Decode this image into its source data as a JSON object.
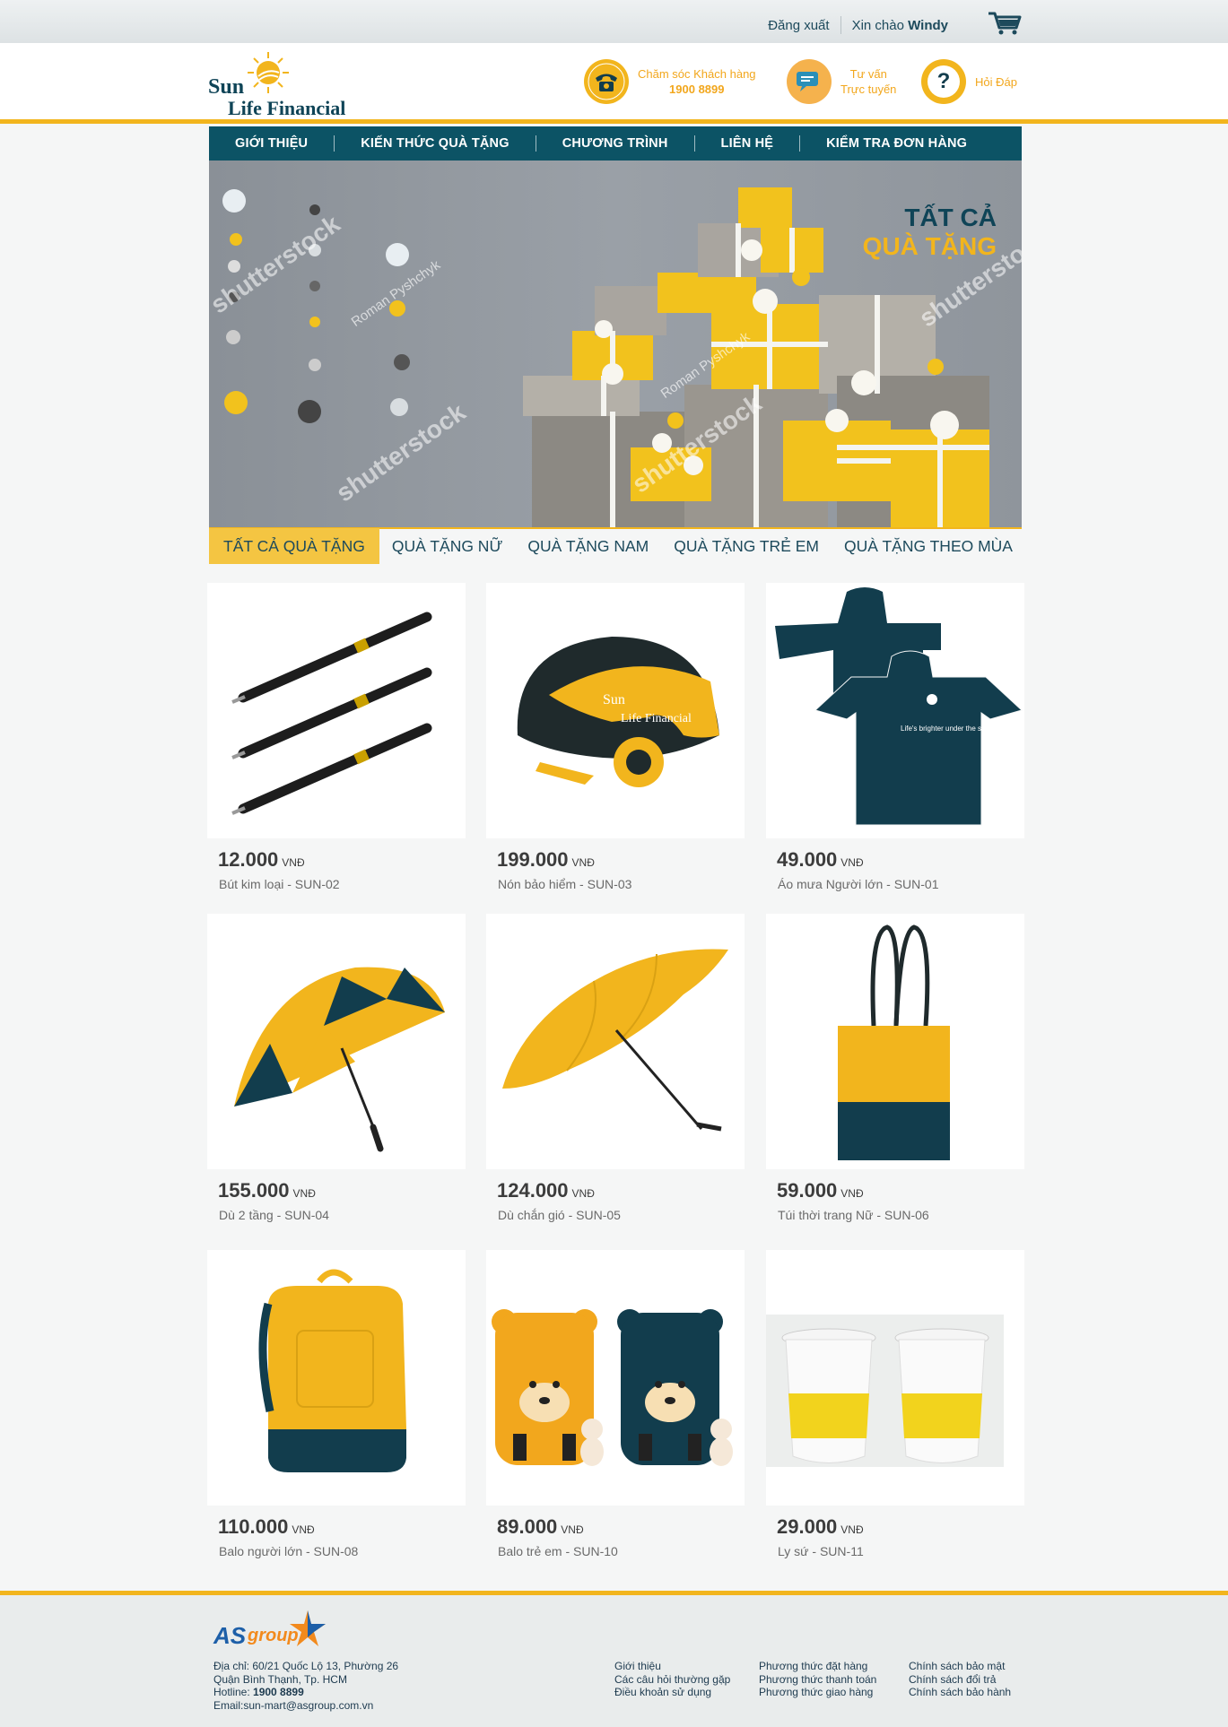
{
  "topbar": {
    "logout": "Đăng xuất",
    "greeting": "Xin chào",
    "username": "Windy"
  },
  "header": {
    "logo_sun": "Sun",
    "logo_lf": "Life Financial",
    "support_label": "Chăm sóc Khách hàng",
    "support_phone": "1900 8899",
    "consult_line1": "Tư vấn",
    "consult_line2": "Trực tuyến",
    "faq": "Hỏi Đáp"
  },
  "nav": {
    "items": [
      "GIỚI THIỆU",
      "KIẾN THỨC QUÀ TẶNG",
      "CHƯƠNG TRÌNH",
      "LIÊN HỆ",
      "KIỂM TRA ĐƠN HÀNG"
    ]
  },
  "banner": {
    "title_line1": "TẤT CẢ",
    "title_line2": "QUÀ TẶNG",
    "watermark": "shutterstock",
    "watermark_author": "Roman Pyshchyk"
  },
  "tabs": [
    "TẤT CẢ QUÀ TẶNG",
    "QUÀ TẶNG NỮ",
    "QUÀ TẶNG NAM",
    "QUÀ TẶNG TRẺ EM",
    "QUÀ TẶNG THEO MÙA"
  ],
  "currency": "VNĐ",
  "products": [
    {
      "price": "12.000",
      "name": "Bút kim loại - SUN-02",
      "icon": "pen-icon"
    },
    {
      "price": "199.000",
      "name": "Nón bảo hiểm - SUN-03",
      "icon": "helmet-icon"
    },
    {
      "price": "49.000",
      "name": "Áo mưa Người lớn - SUN-01",
      "icon": "raincoat-icon"
    },
    {
      "price": "155.000",
      "name": "Dù 2 tầng - SUN-04",
      "icon": "umbrella-icon"
    },
    {
      "price": "124.000",
      "name": "Dù chắn gió - SUN-05",
      "icon": "umbrella-icon"
    },
    {
      "price": "59.000",
      "name": "Túi thời trang Nữ - SUN-06",
      "icon": "tote-bag-icon"
    },
    {
      "price": "110.000",
      "name": "Balo người lớn - SUN-08",
      "icon": "backpack-icon"
    },
    {
      "price": "89.000",
      "name": "Balo trẻ em - SUN-10",
      "icon": "kids-backpack-icon"
    },
    {
      "price": "29.000",
      "name": "Ly sứ - SUN-11",
      "icon": "cup-icon"
    }
  ],
  "product_print": {
    "brand_sun": "Sun",
    "brand_lf": "Life Financial",
    "slogan": "Life's brighter under the sun"
  },
  "footer": {
    "logo_as": "AS",
    "logo_group": "group",
    "address_label": "Địa chỉ:",
    "address_1": "60/21 Quốc Lộ 13, Phường 26",
    "address_2": "Quận Bình Thạnh, Tp. HCM",
    "hotline_label": "Hotline:",
    "hotline": "1900 8899",
    "email_label": "Email:",
    "email": "sun-mart@asgroup.com.vn",
    "col1": [
      "Giới thiệu",
      "Các câu hỏi thường gặp",
      "Điều khoản sử dụng"
    ],
    "col2": [
      "Phương thức đặt hàng",
      "Phương thức thanh toán",
      "Phương thức giao hàng"
    ],
    "col3": [
      "Chính sách bảo mật",
      "Chính sách đổi trả",
      "Chính sách bảo hành"
    ]
  },
  "colors": {
    "brand_yellow": "#f2b51d",
    "brand_teal": "#0c5365",
    "dark_navy": "#123d4d"
  }
}
